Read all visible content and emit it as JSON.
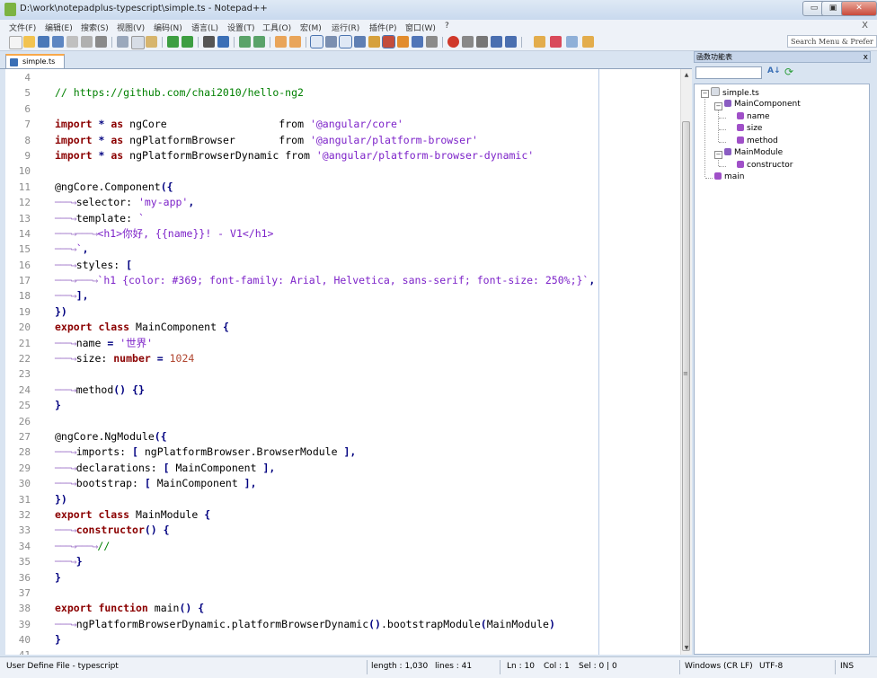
{
  "window": {
    "title": "D:\\work\\notepadplus-typescript\\simple.ts - Notepad++",
    "min_label": "▭",
    "max_label": "▣",
    "close_label": "✕"
  },
  "menubar": {
    "items": [
      "文件(F)",
      "编辑(E)",
      "搜索(S)",
      "视图(V)",
      "编码(N)",
      "语言(L)",
      "设置(T)",
      "工具(O)",
      "宏(M)",
      "运行(R)",
      "插件(P)",
      "窗口(W)",
      "?"
    ],
    "close_label": "X"
  },
  "toolbar": {
    "search_placeholder": "Search Menu & Prefer"
  },
  "tabs": [
    {
      "label": "simple.ts",
      "active": true
    }
  ],
  "editor": {
    "lines": [
      {
        "n": "4",
        "tokens": []
      },
      {
        "n": "5",
        "tokens": [
          {
            "t": "// https://github.com/chai2010/hello-ng2",
            "c": "cmt"
          }
        ]
      },
      {
        "n": "6",
        "tokens": []
      },
      {
        "n": "7",
        "tokens": [
          {
            "t": "import",
            "c": "kw"
          },
          {
            "t": " ",
            "c": ""
          },
          {
            "t": "*",
            "c": "op"
          },
          {
            "t": " ",
            "c": ""
          },
          {
            "t": "as",
            "c": "kw"
          },
          {
            "t": " ngCore                  from ",
            "c": ""
          },
          {
            "t": "'@angular/core'",
            "c": "str"
          }
        ]
      },
      {
        "n": "8",
        "tokens": [
          {
            "t": "import",
            "c": "kw"
          },
          {
            "t": " ",
            "c": ""
          },
          {
            "t": "*",
            "c": "op"
          },
          {
            "t": " ",
            "c": ""
          },
          {
            "t": "as",
            "c": "kw"
          },
          {
            "t": " ngPlatformBrowser       from ",
            "c": ""
          },
          {
            "t": "'@angular/platform-browser'",
            "c": "str"
          }
        ]
      },
      {
        "n": "9",
        "tokens": [
          {
            "t": "import",
            "c": "kw"
          },
          {
            "t": " ",
            "c": ""
          },
          {
            "t": "*",
            "c": "op"
          },
          {
            "t": " ",
            "c": ""
          },
          {
            "t": "as",
            "c": "kw"
          },
          {
            "t": " ngPlatformBrowserDynamic from ",
            "c": ""
          },
          {
            "t": "'@angular/platform-browser-dynamic'",
            "c": "str"
          }
        ]
      },
      {
        "n": "10",
        "tokens": []
      },
      {
        "n": "11",
        "tokens": [
          {
            "t": "@ngCore.Component",
            "c": ""
          },
          {
            "t": "({",
            "c": "op"
          }
        ]
      },
      {
        "n": "12",
        "tokens": [
          {
            "t": "───→",
            "c": "arrow"
          },
          {
            "t": "selector: ",
            "c": ""
          },
          {
            "t": "'my-app'",
            "c": "str"
          },
          {
            "t": ",",
            "c": "op"
          }
        ]
      },
      {
        "n": "13",
        "tokens": [
          {
            "t": "───→",
            "c": "arrow"
          },
          {
            "t": "template: ",
            "c": ""
          },
          {
            "t": "`",
            "c": "str"
          }
        ]
      },
      {
        "n": "14",
        "tokens": [
          {
            "t": "───→───→",
            "c": "arrow"
          },
          {
            "t": "<h1>你好, {{name}}! - V1</h1>",
            "c": "str"
          }
        ]
      },
      {
        "n": "15",
        "tokens": [
          {
            "t": "───→",
            "c": "arrow"
          },
          {
            "t": "`",
            "c": "str"
          },
          {
            "t": ",",
            "c": "op"
          }
        ]
      },
      {
        "n": "16",
        "tokens": [
          {
            "t": "───→",
            "c": "arrow"
          },
          {
            "t": "styles: ",
            "c": ""
          },
          {
            "t": "[",
            "c": "op"
          }
        ]
      },
      {
        "n": "17",
        "tokens": [
          {
            "t": "───→───→",
            "c": "arrow"
          },
          {
            "t": "`h1 {color: #369; font-family: Arial, Helvetica, sans-serif; font-size: 250%;}`",
            "c": "str"
          },
          {
            "t": ",",
            "c": "op"
          }
        ]
      },
      {
        "n": "18",
        "tokens": [
          {
            "t": "───→",
            "c": "arrow"
          },
          {
            "t": "],",
            "c": "op"
          }
        ]
      },
      {
        "n": "19",
        "tokens": [
          {
            "t": "})",
            "c": "op"
          }
        ]
      },
      {
        "n": "20",
        "tokens": [
          {
            "t": "export class",
            "c": "kw"
          },
          {
            "t": " MainComponent ",
            "c": ""
          },
          {
            "t": "{",
            "c": "op"
          }
        ]
      },
      {
        "n": "21",
        "tokens": [
          {
            "t": "───→",
            "c": "arrow"
          },
          {
            "t": "name ",
            "c": ""
          },
          {
            "t": "=",
            "c": "op"
          },
          {
            "t": " ",
            "c": ""
          },
          {
            "t": "'世界'",
            "c": "str"
          }
        ]
      },
      {
        "n": "22",
        "tokens": [
          {
            "t": "───→",
            "c": "arrow"
          },
          {
            "t": "size: ",
            "c": ""
          },
          {
            "t": "number",
            "c": "kw"
          },
          {
            "t": " ",
            "c": ""
          },
          {
            "t": "=",
            "c": "op"
          },
          {
            "t": " ",
            "c": ""
          },
          {
            "t": "1024",
            "c": "num"
          }
        ]
      },
      {
        "n": "23",
        "tokens": []
      },
      {
        "n": "24",
        "tokens": [
          {
            "t": "───→",
            "c": "arrow"
          },
          {
            "t": "method",
            "c": ""
          },
          {
            "t": "()",
            "c": "op"
          },
          {
            "t": " ",
            "c": ""
          },
          {
            "t": "{}",
            "c": "op"
          }
        ]
      },
      {
        "n": "25",
        "tokens": [
          {
            "t": "}",
            "c": "op"
          }
        ]
      },
      {
        "n": "26",
        "tokens": []
      },
      {
        "n": "27",
        "tokens": [
          {
            "t": "@ngCore.NgModule",
            "c": ""
          },
          {
            "t": "({",
            "c": "op"
          }
        ]
      },
      {
        "n": "28",
        "tokens": [
          {
            "t": "───→",
            "c": "arrow"
          },
          {
            "t": "imports: ",
            "c": ""
          },
          {
            "t": "[",
            "c": "op"
          },
          {
            "t": " ngPlatformBrowser.BrowserModule ",
            "c": ""
          },
          {
            "t": "],",
            "c": "op"
          }
        ]
      },
      {
        "n": "29",
        "tokens": [
          {
            "t": "───→",
            "c": "arrow"
          },
          {
            "t": "declarations: ",
            "c": ""
          },
          {
            "t": "[",
            "c": "op"
          },
          {
            "t": " MainComponent ",
            "c": ""
          },
          {
            "t": "],",
            "c": "op"
          }
        ]
      },
      {
        "n": "30",
        "tokens": [
          {
            "t": "───→",
            "c": "arrow"
          },
          {
            "t": "bootstrap: ",
            "c": ""
          },
          {
            "t": "[",
            "c": "op"
          },
          {
            "t": " MainComponent ",
            "c": ""
          },
          {
            "t": "],",
            "c": "op"
          }
        ]
      },
      {
        "n": "31",
        "tokens": [
          {
            "t": "})",
            "c": "op"
          }
        ]
      },
      {
        "n": "32",
        "tokens": [
          {
            "t": "export class",
            "c": "kw"
          },
          {
            "t": " MainModule ",
            "c": ""
          },
          {
            "t": "{",
            "c": "op"
          }
        ]
      },
      {
        "n": "33",
        "tokens": [
          {
            "t": "───→",
            "c": "arrow"
          },
          {
            "t": "constructor",
            "c": "kw"
          },
          {
            "t": "()",
            "c": "op"
          },
          {
            "t": " ",
            "c": ""
          },
          {
            "t": "{",
            "c": "op"
          }
        ]
      },
      {
        "n": "34",
        "tokens": [
          {
            "t": "───→───→",
            "c": "arrow"
          },
          {
            "t": "//",
            "c": "cmt"
          }
        ]
      },
      {
        "n": "35",
        "tokens": [
          {
            "t": "───→",
            "c": "arrow"
          },
          {
            "t": "}",
            "c": "op"
          }
        ]
      },
      {
        "n": "36",
        "tokens": [
          {
            "t": "}",
            "c": "op"
          }
        ]
      },
      {
        "n": "37",
        "tokens": []
      },
      {
        "n": "38",
        "tokens": [
          {
            "t": "export function",
            "c": "kw"
          },
          {
            "t": " main",
            "c": ""
          },
          {
            "t": "()",
            "c": "op"
          },
          {
            "t": " ",
            "c": ""
          },
          {
            "t": "{",
            "c": "op"
          }
        ]
      },
      {
        "n": "39",
        "tokens": [
          {
            "t": "───→",
            "c": "arrow"
          },
          {
            "t": "ngPlatformBrowserDynamic.platformBrowserDynamic",
            "c": ""
          },
          {
            "t": "()",
            "c": "op"
          },
          {
            "t": ".bootstrapModule",
            "c": ""
          },
          {
            "t": "(",
            "c": "op"
          },
          {
            "t": "MainModule",
            "c": ""
          },
          {
            "t": ")",
            "c": "op"
          }
        ]
      },
      {
        "n": "40",
        "tokens": [
          {
            "t": "}",
            "c": "op"
          }
        ]
      },
      {
        "n": "41",
        "tokens": []
      }
    ]
  },
  "function_panel": {
    "title": "函数功能表",
    "close_label": "x",
    "sort_icon_label": "A↓",
    "refresh_icon_label": "⟳",
    "tree": {
      "root": "simple.ts",
      "main_component": "MainComponent",
      "mc_name": "name",
      "mc_size": "size",
      "mc_method": "method",
      "main_module": "MainModule",
      "mm_constructor": "constructor",
      "main": "main"
    }
  },
  "statusbar": {
    "file_type": "User Define File - typescript",
    "length": "length : 1,030",
    "lines": "lines : 41",
    "ln": "Ln : 10",
    "col": "Col : 1",
    "sel": "Sel : 0 | 0",
    "eol": "Windows (CR LF)",
    "encoding": "UTF-8",
    "mode": "INS"
  },
  "colors": {
    "keyword": "#8b0000",
    "string": "#7d23c9",
    "comment": "#008000",
    "number": "#b0452f",
    "operator": "#000080",
    "tab_active_accent": "#f8a84a"
  }
}
